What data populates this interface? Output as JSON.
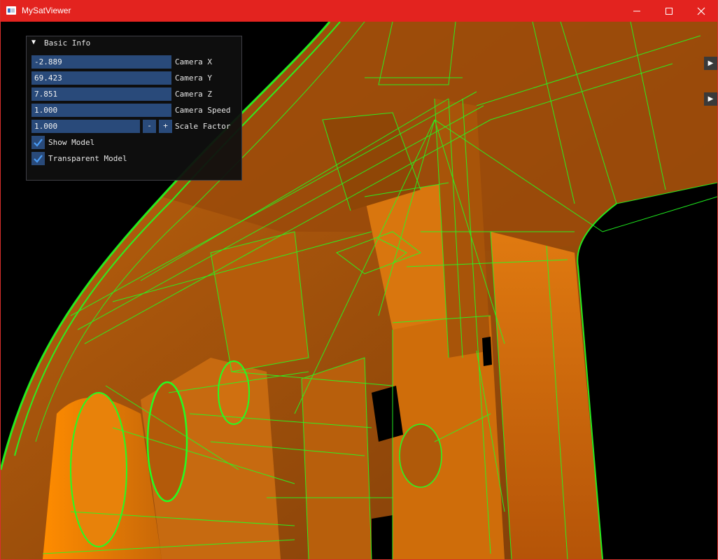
{
  "window": {
    "title": "MySatViewer",
    "controls": [
      "minimize-icon",
      "maximize-icon",
      "close-icon"
    ]
  },
  "colors": {
    "titlebar": "#e3231f",
    "wireframe": "#22ff22",
    "model_fill": "#d96a0a",
    "panel_bg": "#0f0f0f",
    "field_bg": "#294a7a",
    "check_mark": "#4a9cf5"
  },
  "panel": {
    "header": "Basic Info",
    "fields": [
      {
        "value": "-2.889",
        "label": "Camera X"
      },
      {
        "value": "69.423",
        "label": "Camera Y"
      },
      {
        "value": "7.851",
        "label": "Camera Z"
      },
      {
        "value": "1.000",
        "label": "Camera Speed"
      }
    ],
    "scale": {
      "value": "1.000",
      "minus": "-",
      "plus": "+",
      "label": "Scale Factor"
    },
    "checkboxes": [
      {
        "label": "Show Model",
        "checked": true
      },
      {
        "label": "Transparent Model",
        "checked": true
      }
    ]
  },
  "side_buttons": [
    "play-icon",
    "play-icon"
  ]
}
